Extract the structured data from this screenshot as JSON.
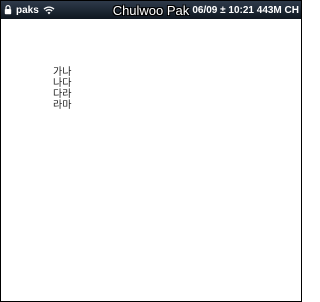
{
  "status_bar": {
    "carrier": "paks",
    "right_text": "06/09 ± 10:21 443M CH",
    "icons": [
      "lock-icon",
      "wifi-icon"
    ]
  },
  "watermark": "Chulwoo Pak",
  "list": {
    "items": [
      "가나",
      "나다",
      "다라",
      "라마"
    ]
  },
  "colors": {
    "status_bar_bg": "#1a2330",
    "status_text": "#ffffff",
    "background": "#ffffff",
    "text": "#222222"
  }
}
